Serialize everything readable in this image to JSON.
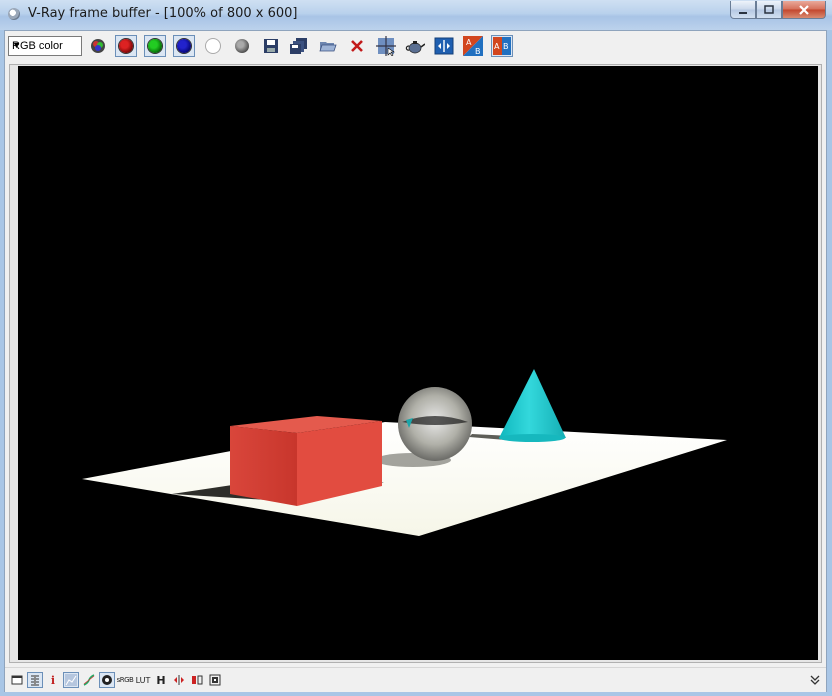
{
  "window": {
    "title": "V-Ray frame buffer - [100% of 800 x 600]",
    "caption_buttons": [
      "minimize",
      "maximize",
      "close"
    ]
  },
  "toolbar": {
    "channel_select": "RGB color",
    "buttons": [
      "show-channels-icon",
      "red-channel-icon",
      "green-channel-icon",
      "blue-channel-icon",
      "white-channel-icon",
      "mono-channel-icon",
      "save-image-icon",
      "save-all-channels-icon",
      "load-image-icon",
      "clear-image-icon",
      "track-mouse-icon",
      "render-teapot-icon",
      "compare-horizontal-icon",
      "ab-swap-icon",
      "ab-compare-icon"
    ]
  },
  "render": {
    "scene": "3D render: red box, glass sphere, cyan cone on a white plane",
    "colors": {
      "background": "#000000",
      "plane": "#fdfdf4",
      "box": "#e0463a",
      "cone": "#1fc7cc"
    }
  },
  "statusbar": {
    "info_label": "i",
    "srgb_label": "sRGB",
    "lut_label": "LUT",
    "h_label": "H"
  }
}
